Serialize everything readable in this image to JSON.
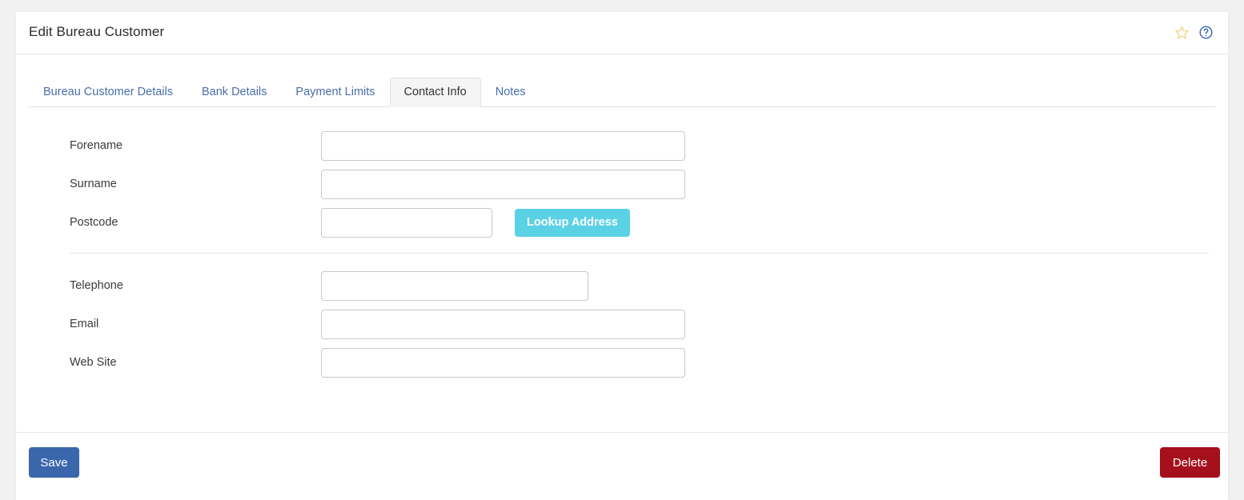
{
  "page": {
    "background_color": "#f1f1f1"
  },
  "panel": {
    "title": "Edit Bureau Customer",
    "header_icons": [
      {
        "name": "favourite-star-icon",
        "glyph": "star",
        "color": "#f5dd8f",
        "title": "Add to favourites"
      },
      {
        "name": "help-icon",
        "glyph": "question-circle",
        "color": "#3a66ac",
        "title": "Help"
      }
    ]
  },
  "tabs": [
    {
      "label": "Bureau Customer Details",
      "active": false
    },
    {
      "label": "Bank Details",
      "active": false
    },
    {
      "label": "Payment Limits",
      "active": false
    },
    {
      "label": "Contact Info",
      "active": true
    },
    {
      "label": "Notes",
      "active": false
    }
  ],
  "form": {
    "group_one": [
      {
        "label": "Forename",
        "value": "",
        "placeholder": "",
        "width": "wide"
      },
      {
        "label": "Surname",
        "value": "",
        "placeholder": "",
        "width": "wide"
      },
      {
        "label": "Postcode",
        "value": "",
        "placeholder": "",
        "width": "short"
      }
    ],
    "lookup_button": "Lookup Address",
    "group_two": [
      {
        "label": "Telephone",
        "value": "",
        "placeholder": "",
        "width": "medium"
      },
      {
        "label": "Email",
        "value": "",
        "placeholder": "",
        "width": "wide"
      },
      {
        "label": "Web Site",
        "value": "",
        "placeholder": "",
        "width": "wide"
      }
    ]
  },
  "footer": {
    "save_label": "Save",
    "delete_label": "Delete"
  },
  "colors": {
    "primary_button": "#3a66ac",
    "danger_button": "#a5101c",
    "accent_button": "#5bd1e6",
    "tab_link": "#4a6ea9",
    "active_tab_bg": "#f5f5f5",
    "border": "#e0e0e0"
  }
}
